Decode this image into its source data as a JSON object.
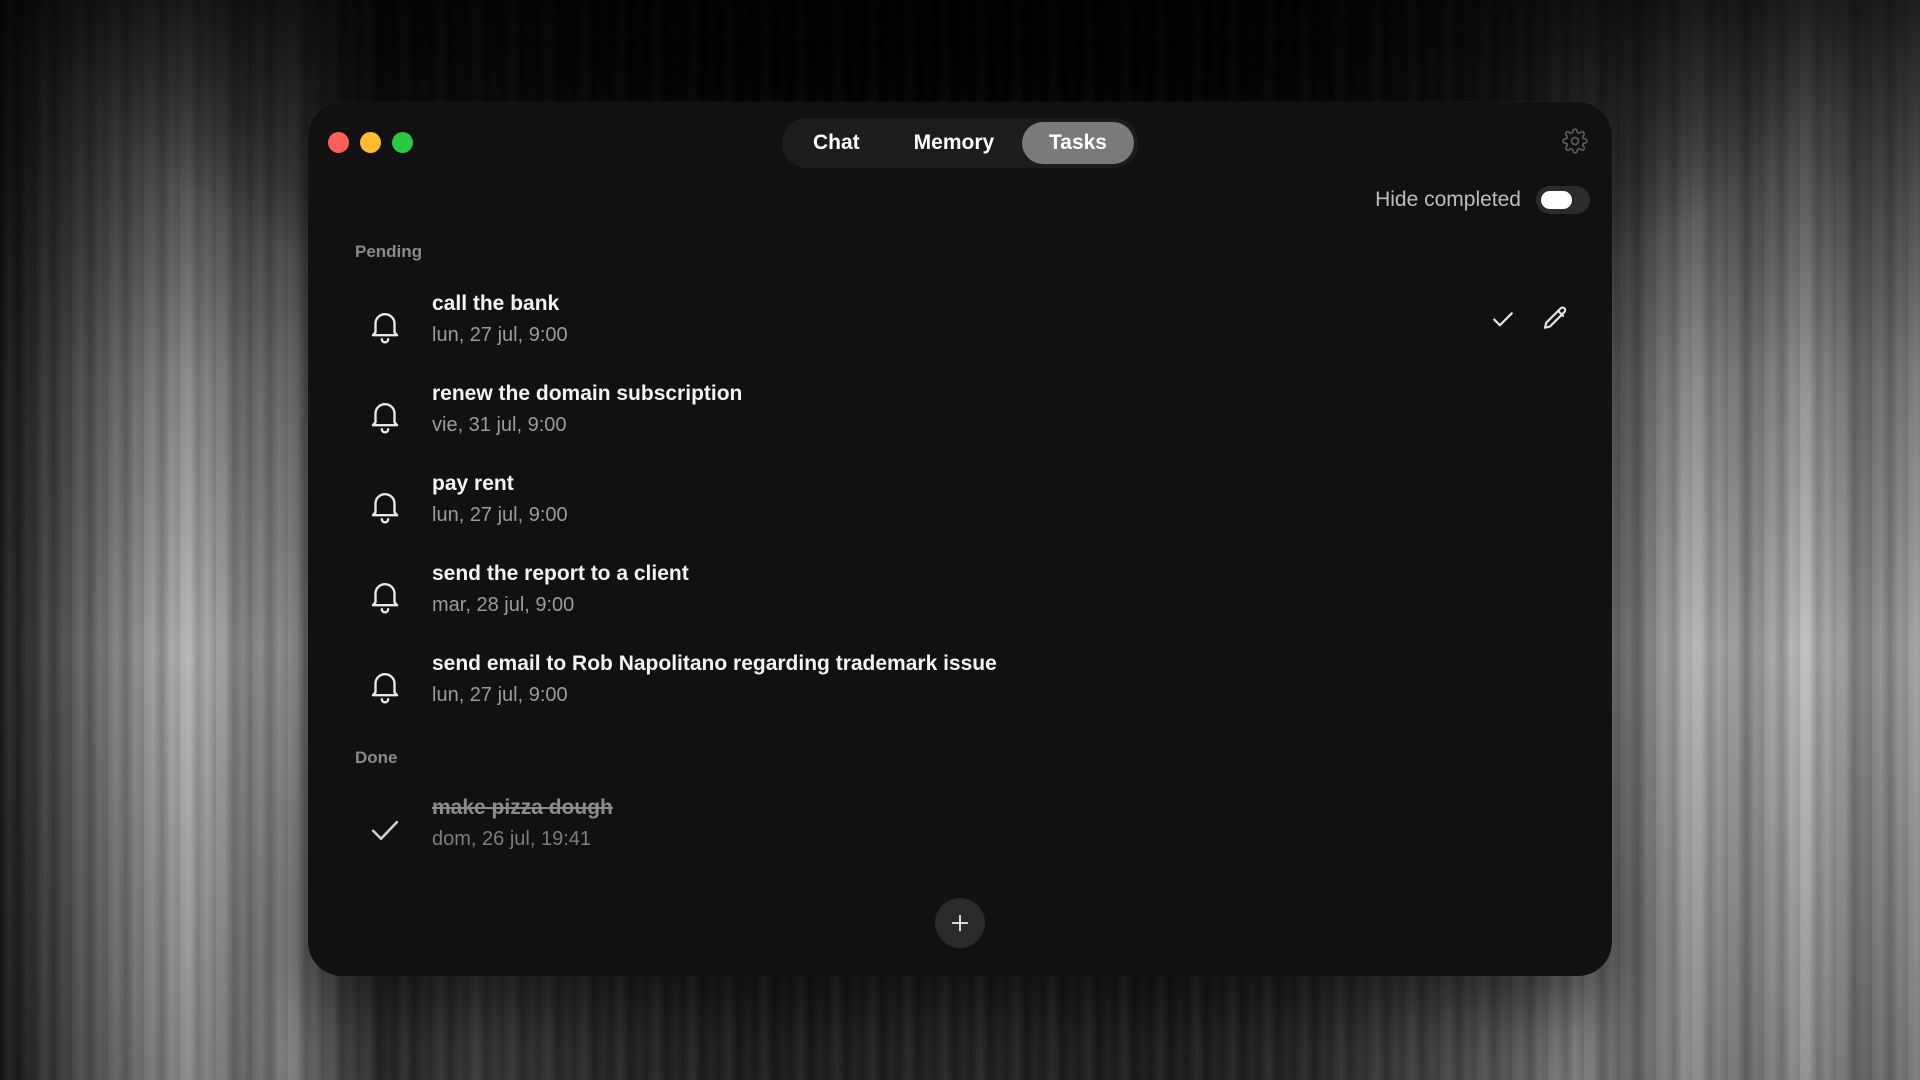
{
  "tabs": [
    {
      "label": "Chat",
      "active": false
    },
    {
      "label": "Memory",
      "active": false
    },
    {
      "label": "Tasks",
      "active": true
    }
  ],
  "toggle": {
    "label": "Hide completed",
    "on": true
  },
  "sections": {
    "pending_label": "Pending",
    "done_label": "Done"
  },
  "pending": [
    {
      "title": "call the bank",
      "date": "lun, 27 jul, 9:00",
      "icon": "bell-icon"
    },
    {
      "title": "renew the domain subscription",
      "date": "vie, 31 jul, 9:00",
      "icon": "bell-icon"
    },
    {
      "title": "pay rent",
      "date": "lun, 27 jul, 9:00",
      "icon": "bell-icon"
    },
    {
      "title": "send the report to a client",
      "date": "mar, 28 jul, 9:00",
      "icon": "bell-icon"
    },
    {
      "title": "send email to Rob Napolitano regarding trademark issue",
      "date": "lun, 27 jul, 9:00",
      "icon": "bell-icon"
    }
  ],
  "done": [
    {
      "title": "make pizza dough",
      "date": "dom, 26 jul, 19:41",
      "icon": "check-icon"
    }
  ],
  "icons": {
    "settings": "gear-icon",
    "complete": "check-icon",
    "edit": "pencil-icon",
    "add": "plus-icon"
  },
  "colors": {
    "close": "#ff5f57",
    "minimize": "#febc2e",
    "zoom": "#28c840",
    "window_bg": "#111111",
    "active_tab": "#7a7a7a"
  }
}
